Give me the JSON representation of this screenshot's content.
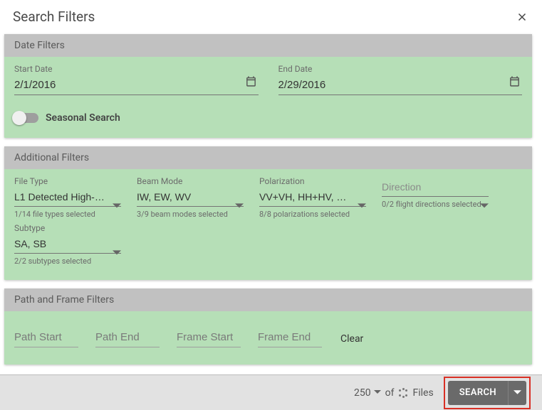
{
  "header": {
    "title": "Search Filters"
  },
  "dateFilters": {
    "section_title": "Date Filters",
    "start": {
      "label": "Start Date",
      "value": "2/1/2016"
    },
    "end": {
      "label": "End Date",
      "value": "2/29/2016"
    },
    "seasonal_label": "Seasonal Search",
    "seasonal_on": false
  },
  "additionalFilters": {
    "section_title": "Additional Filters",
    "fileType": {
      "label": "File Type",
      "value": "L1 Detected High-Re…",
      "helper": "1/14 file types selected"
    },
    "beamMode": {
      "label": "Beam Mode",
      "value": "IW, EW, WV",
      "helper": "3/9 beam modes selected"
    },
    "polarization": {
      "label": "Polarization",
      "value": "VV+VH, HH+HV, VV, …",
      "helper": "8/8 polarizations selected"
    },
    "direction": {
      "label": "",
      "placeholder": "Direction",
      "helper": "0/2 flight directions selected"
    },
    "subtype": {
      "label": "Subtype",
      "value": "SA, SB",
      "helper": "2/2 subtypes selected"
    }
  },
  "pathFrame": {
    "section_title": "Path and Frame Filters",
    "path_start_ph": "Path Start",
    "path_end_ph": "Path End",
    "frame_start_ph": "Frame Start",
    "frame_end_ph": "Frame End",
    "clear_label": "Clear"
  },
  "footer": {
    "count": "250",
    "of_label": "of",
    "files_label": "Files",
    "search_label": "SEARCH"
  }
}
